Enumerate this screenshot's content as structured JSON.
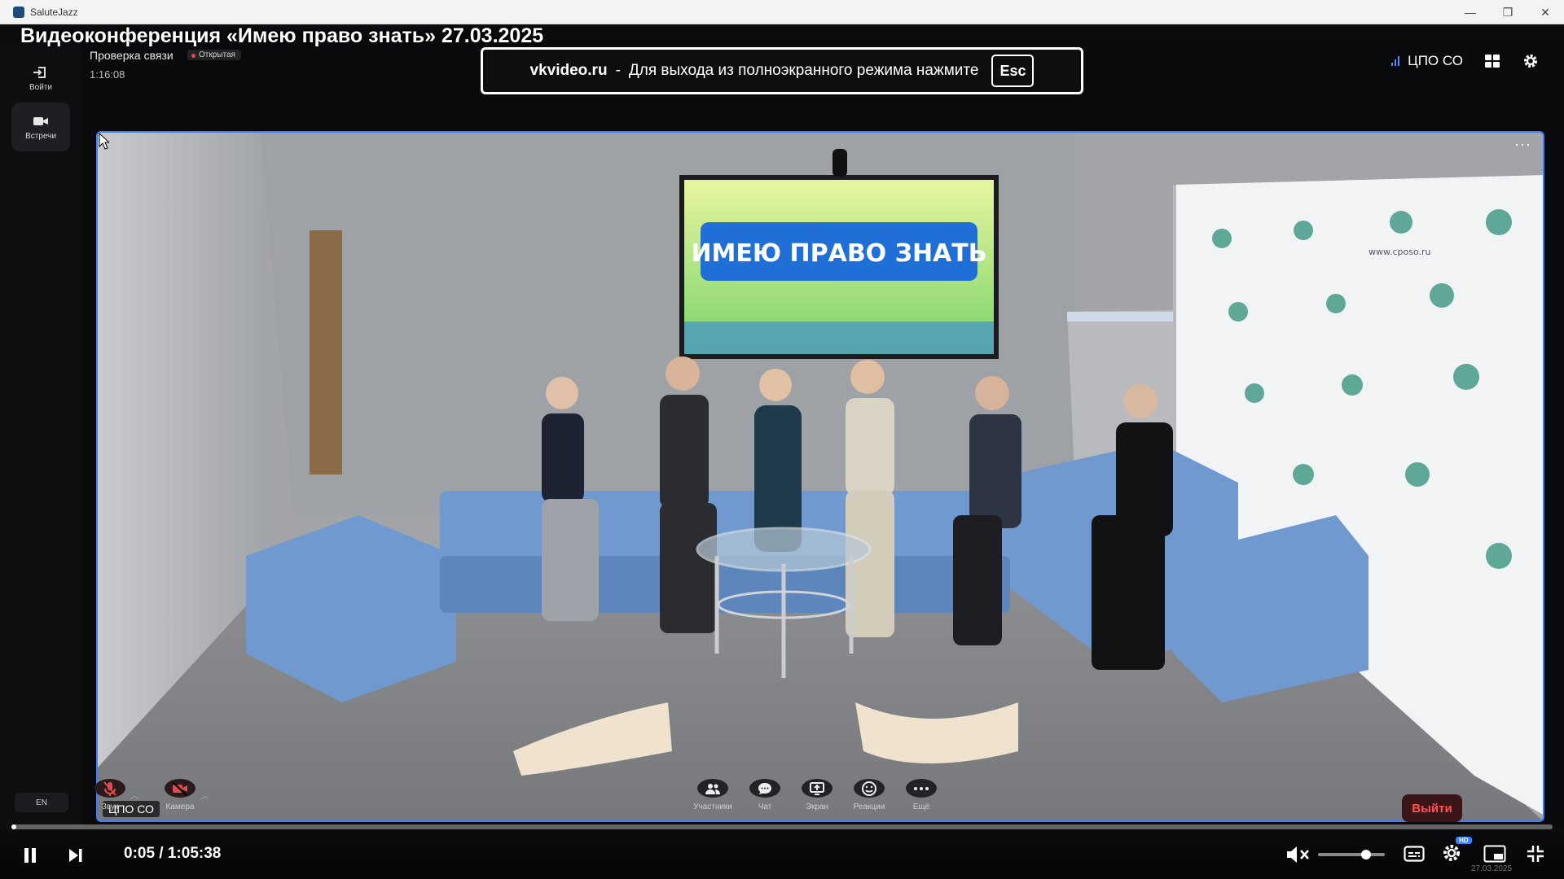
{
  "window": {
    "app_title": "SaluteJazz",
    "minimize_glyph": "—",
    "maximize_glyph": "❐",
    "close_glyph": "✕"
  },
  "video_title": "Видеоконференция «Имею право знать» 27.03.2025",
  "rail": {
    "login_label": "Войти",
    "meetings_label": "Встречи",
    "language": "EN"
  },
  "meeting": {
    "name": "Проверка связи",
    "badge": "Открытая",
    "elapsed": "1:16:08",
    "organization": "ЦПО СО"
  },
  "fullscreen_notice": {
    "domain": "vkvideo.ru",
    "separator": "-",
    "message": "Для выхода из полноэкранного режима нажмите",
    "key": "Esc"
  },
  "stage": {
    "more_glyph": "···",
    "speaker_label": "ЦПО СО",
    "screen_banner": "ИМЕЮ ПРАВО ЗНАТЬ",
    "backdrop_text": "www.cposo.ru"
  },
  "controls": {
    "sound_label": "Звук",
    "camera_label": "Камера",
    "participants_label": "Участники",
    "chat_label": "Чат",
    "screen_label": "Экран",
    "reactions_label": "Реакции",
    "more_label": "Ещё",
    "leave_label": "Выйти"
  },
  "player": {
    "time": "0:05 / 1:05:38",
    "progress": 0.0013,
    "volume_muted": true,
    "volume_level": 0.72,
    "hd_badge": "HD",
    "tray_date": "27.03.2025"
  },
  "colors": {
    "accent": "#3d7bff",
    "leave": "#ff5252",
    "muted_icon": "#e24c4c"
  }
}
